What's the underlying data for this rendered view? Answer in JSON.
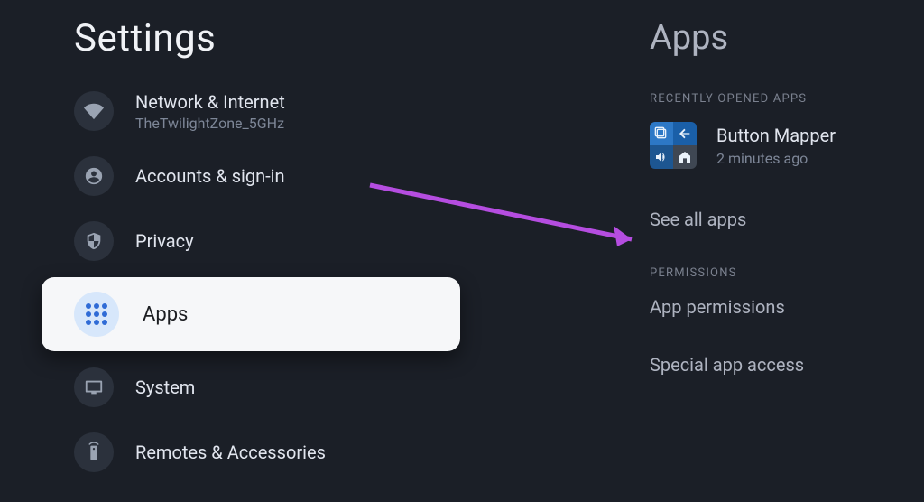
{
  "left": {
    "title": "Settings",
    "items": [
      {
        "label": "Network & Internet",
        "sub": "TheTwilightZone_5GHz"
      },
      {
        "label": "Accounts & sign-in"
      },
      {
        "label": "Privacy"
      },
      {
        "label": "Apps"
      },
      {
        "label": "System"
      },
      {
        "label": "Remotes & Accessories"
      }
    ]
  },
  "right": {
    "title": "Apps",
    "recent_header": "RECENTLY OPENED APPS",
    "recent_app": {
      "name": "Button Mapper",
      "time": "2 minutes ago"
    },
    "see_all": "See all apps",
    "permissions_header": "PERMISSIONS",
    "app_permissions": "App permissions",
    "special_access": "Special app access"
  }
}
